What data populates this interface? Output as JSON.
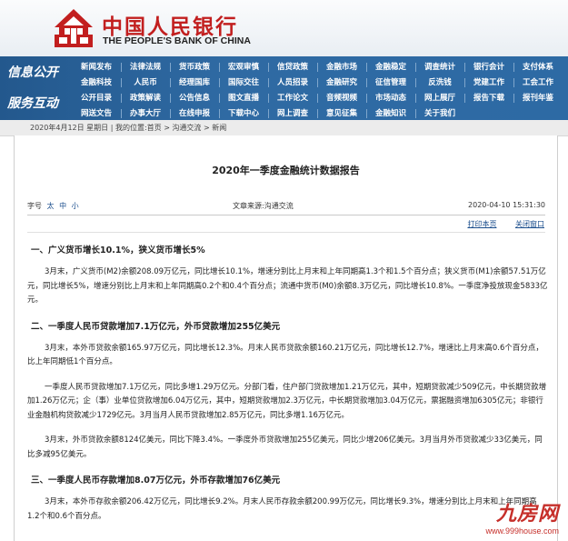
{
  "header": {
    "title_cn": "中国人民银行",
    "title_en": "THE PEOPLE'S BANK OF CHINA"
  },
  "nav": {
    "label1": "信息公开",
    "label2": "服务互动",
    "rows": [
      [
        "新闻发布",
        "法律法规",
        "货币政策",
        "宏观审慎",
        "信贷政策",
        "金融市场",
        "金融稳定",
        "调查统计",
        "银行会计",
        "支付体系"
      ],
      [
        "金融科技",
        "人民币",
        "经理国库",
        "国际交往",
        "人员招录",
        "金融研究",
        "征信管理",
        "反洗钱",
        "党建工作",
        "工会工作"
      ],
      [
        "公开目录",
        "政策解读",
        "公告信息",
        "图文直播",
        "工作论文",
        "音频视频",
        "市场动态",
        "网上展厅",
        "报告下载",
        "报刊年鉴"
      ],
      [
        "网送文告",
        "办事大厅",
        "在线申报",
        "下载中心",
        "网上调查",
        "意见征集",
        "金融知识",
        "关于我们",
        "",
        ""
      ]
    ]
  },
  "breadcrumb": "2020年4月12日 星期日 | 我的位置:首页 > 沟通交流 > 新闻",
  "article": {
    "title": "2020年一季度金融统计数据报告",
    "fontsize_label": "字号",
    "font_big": "太",
    "font_mid": "中",
    "font_small": "小",
    "source": "文章来源:沟通交流",
    "date": "2020-04-10 15:31:30",
    "print": "打印本页",
    "close": "关闭窗口",
    "sections": [
      {
        "heading": "一、广义货币增长10.1%，狭义货币增长5%",
        "paragraphs": [
          "3月末，广义货币(M2)余额208.09万亿元，同比增长10.1%，增速分别比上月末和上年同期高1.3个和1.5个百分点；狭义货币(M1)余额57.51万亿元，同比增长5%，增速分别比上月末和上年同期高0.2个和0.4个百分点；流通中货币(M0)余额8.3万亿元，同比增长10.8%。一季度净投放现金5833亿元。"
        ]
      },
      {
        "heading": "二、一季度人民币贷款增加7.1万亿元，外币贷款增加255亿美元",
        "paragraphs": [
          "3月末，本外币贷款余额165.97万亿元，同比增长12.3%。月末人民币贷款余额160.21万亿元，同比增长12.7%，增速比上月末高0.6个百分点，比上年同期低1个百分点。",
          "一季度人民币贷款增加7.1万亿元，同比多增1.29万亿元。分部门看，住户部门贷款增加1.21万亿元，其中，短期贷款减少509亿元，中长期贷款增加1.26万亿元；企（事）业单位贷款增加6.04万亿元，其中，短期贷款增加2.3万亿元，中长期贷款增加3.04万亿元，票据融资增加6305亿元；非银行业金融机构贷款减少1729亿元。3月当月人民币贷款增加2.85万亿元，同比多增1.16万亿元。",
          "3月末，外币贷款余额8124亿美元，同比下降3.4%。一季度外币贷款增加255亿美元，同比少增206亿美元。3月当月外币贷款减少33亿美元，同比多减95亿美元。"
        ]
      },
      {
        "heading": "三、一季度人民币存款增加8.07万亿元，外币存款增加76亿美元",
        "paragraphs": [
          "3月末，本外币存款余额206.42万亿元，同比增长9.2%。月末人民币存款余额200.99万亿元，同比增长9.3%，增速分别比上月末和上年同期高1.2个和0.6个百分点。"
        ]
      }
    ]
  },
  "watermark": {
    "text": "九房网",
    "url": "www.999house.com"
  },
  "colors": {
    "brand_red": "#c21f1f",
    "nav_blue": "#2d6aa4",
    "link_blue": "#1a4d8c"
  }
}
